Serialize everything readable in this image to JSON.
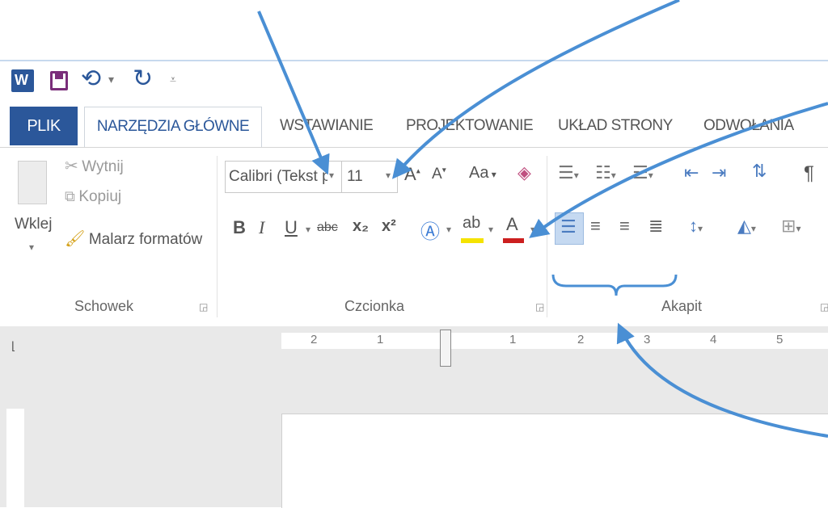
{
  "colors": {
    "accent": "#2b579a",
    "arrow": "#4a8fd4",
    "word_icon": "#2b579a",
    "highlight": "#f5e300",
    "font_color": "#cc1f1f"
  },
  "qat": {
    "icons": [
      "word-logo-icon",
      "save-icon",
      "undo-icon",
      "redo-icon",
      "customize-qat-icon"
    ]
  },
  "tabs": [
    "PLIK",
    "NARZĘDZIA GŁÓWNE",
    "WSTAWIANIE",
    "PROJEKTOWANIE",
    "UKŁAD STRONY",
    "ODWOŁANIA"
  ],
  "clipboard": {
    "paste": "Wklej",
    "cut": "Wytnij",
    "copy": "Kopiuj",
    "format_painter": "Malarz formatów",
    "group_label": "Schowek"
  },
  "font": {
    "font_name": "Calibri (Tekst p",
    "font_size": "11",
    "change_case": "Aa",
    "bold": "B",
    "italic": "I",
    "underline": "U",
    "strikethrough": "abc",
    "subscript": "x₂",
    "superscript": "x²",
    "group_label": "Czcionka"
  },
  "paragraph": {
    "group_label": "Akapit"
  },
  "ruler": {
    "numbers": [
      "2",
      "1",
      "1",
      "2",
      "3",
      "4",
      "5"
    ]
  }
}
